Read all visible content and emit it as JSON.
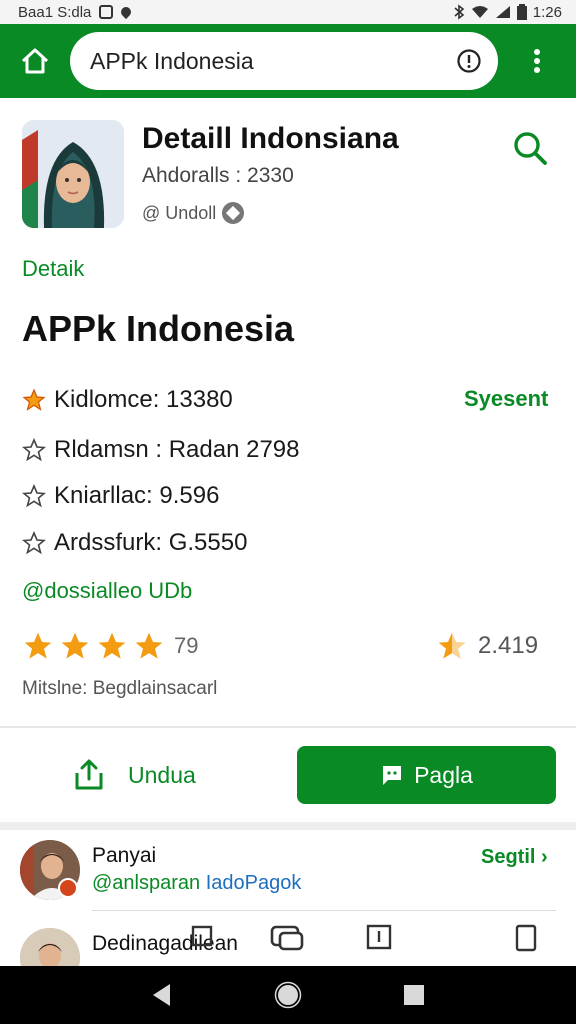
{
  "status_bar": {
    "time_left": "Baa1 S:dla",
    "time_right": "1:26"
  },
  "toolbar": {
    "url": "APPk Indonesia"
  },
  "app": {
    "title": "Detaill Indonsiana",
    "subtitle": "Ahdoralls : 2330",
    "meta": "@ Undoll"
  },
  "section": {
    "label": "Detaik",
    "title": "APPk Indonesia"
  },
  "stats": [
    {
      "label": "Kidlomce: 13380"
    },
    {
      "label": "Rldamsn : Radan 2798"
    },
    {
      "label": "Kniarllac: 9.596"
    },
    {
      "label": "Ardssfurk: G.5550"
    }
  ],
  "stats_link": "Syesent",
  "handle": "@dossialleo UDb",
  "rating": {
    "stars": 4,
    "count": "79",
    "right_value": "2.419"
  },
  "meta_line": "Mitslne: Begdlainsacarl",
  "actions": {
    "share_label": "Undua",
    "primary_label": "Pagla"
  },
  "list": [
    {
      "name": "Panyai",
      "handle_prefix": "@anlsparan ",
      "handle_link": "IadoPagok",
      "action": "Segtil ›"
    },
    {
      "name": "Dedinagadilean"
    }
  ],
  "colors": {
    "primary": "#0a8a25",
    "star": "#f39c12",
    "link": "#1e6fbf"
  }
}
